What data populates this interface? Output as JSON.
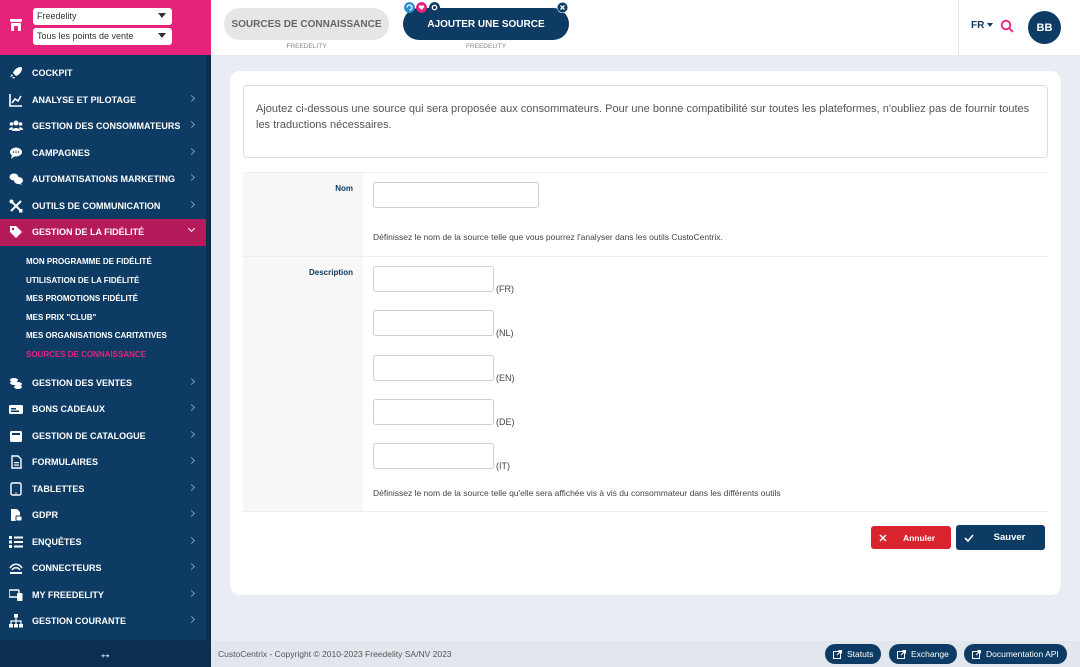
{
  "sidebar": {
    "store_select": "Freedelity",
    "pos_select": "Tous les points de vente",
    "menu_top": [
      {
        "label": "COCKPIT",
        "icon": "rocket-icon",
        "chevron": false
      },
      {
        "label": "ANALYSE ET PILOTAGE",
        "icon": "chart-line-icon",
        "chevron": true
      },
      {
        "label": "GESTION DES CONSOMMATEURS",
        "icon": "users-icon",
        "chevron": true
      },
      {
        "label": "CAMPAGNES",
        "icon": "chat-bubble-icon",
        "chevron": true
      },
      {
        "label": "AUTOMATISATIONS MARKETING",
        "icon": "comments-icon",
        "chevron": true
      },
      {
        "label": "OUTILS DE COMMUNICATION",
        "icon": "tools-icon",
        "chevron": true
      },
      {
        "label": "GESTION DE LA FIDÉLITÉ",
        "icon": "loyalty-tag-icon",
        "chevron": true
      }
    ],
    "submenu": [
      "MON PROGRAMME DE FIDÉLITÉ",
      "UTILISATION DE LA FIDÉLITÉ",
      "MES PROMOTIONS FIDÉLITÉ",
      "MES PRIX \"CLUB\"",
      "MES ORGANISATIONS CARITATIVES",
      "SOURCES DE CONNAISSANCE"
    ],
    "menu_bottom": [
      {
        "label": "GESTION DES VENTES",
        "icon": "coins-icon"
      },
      {
        "label": "BONS CADEAUX",
        "icon": "gift-card-icon"
      },
      {
        "label": "GESTION DE CATALOGUE",
        "icon": "catalog-icon"
      },
      {
        "label": "FORMULAIRES",
        "icon": "form-icon"
      },
      {
        "label": "TABLETTES",
        "icon": "tablet-icon"
      },
      {
        "label": "GDPR",
        "icon": "document-lock-icon"
      },
      {
        "label": "ENQUÊTES",
        "icon": "survey-icon"
      },
      {
        "label": "CONNECTEURS",
        "icon": "connector-icon"
      },
      {
        "label": "MY FREEDELITY",
        "icon": "devices-icon"
      },
      {
        "label": "GESTION COURANTE",
        "icon": "sitemap-icon"
      }
    ],
    "collapse_glyph": "↔"
  },
  "topbar": {
    "tab1_label": "SOURCES DE CONNAISSANCE",
    "tab1_sub": "FREEDELITY",
    "tab2_label": "AJOUTER UNE SOURCE",
    "tab2_sub": "FREEDELITY",
    "lang": "FR",
    "avatar": "BB"
  },
  "form": {
    "intro": "Ajoutez ci-dessous une source qui sera proposée aux consommateurs. Pour une bonne compatibilité sur toutes les plateformes, n'oubliez pas de fournir toutes les traductions nécessaires.",
    "nom_label": "Nom",
    "nom_value": "",
    "nom_help": "Définissez le nom de la source telle que vous pourrez l'analyser dans les outils CustoCentrix.",
    "desc_label": "Description",
    "desc_fields": [
      {
        "lang": "(FR)",
        "value": ""
      },
      {
        "lang": "(NL)",
        "value": ""
      },
      {
        "lang": "(EN)",
        "value": ""
      },
      {
        "lang": "(DE)",
        "value": ""
      },
      {
        "lang": "(IT)",
        "value": ""
      }
    ],
    "desc_help": "Définissez le nom de la source telle qu'elle sera affichée vis à vis du consommateur dans les différents outils",
    "cancel_label": "Annuler",
    "save_label": "Sauver"
  },
  "footer": {
    "copyright": "CustoCentrix - Copyright © 2010-2023 Freedelity SA/NV 2023",
    "links": [
      "Statuts",
      "Exchange",
      "Documentation API"
    ]
  },
  "colors": {
    "brand_pink": "#e6237b",
    "navy": "#0d3b63",
    "active_item": "#b51a5b",
    "cancel_red": "#d9232e"
  }
}
